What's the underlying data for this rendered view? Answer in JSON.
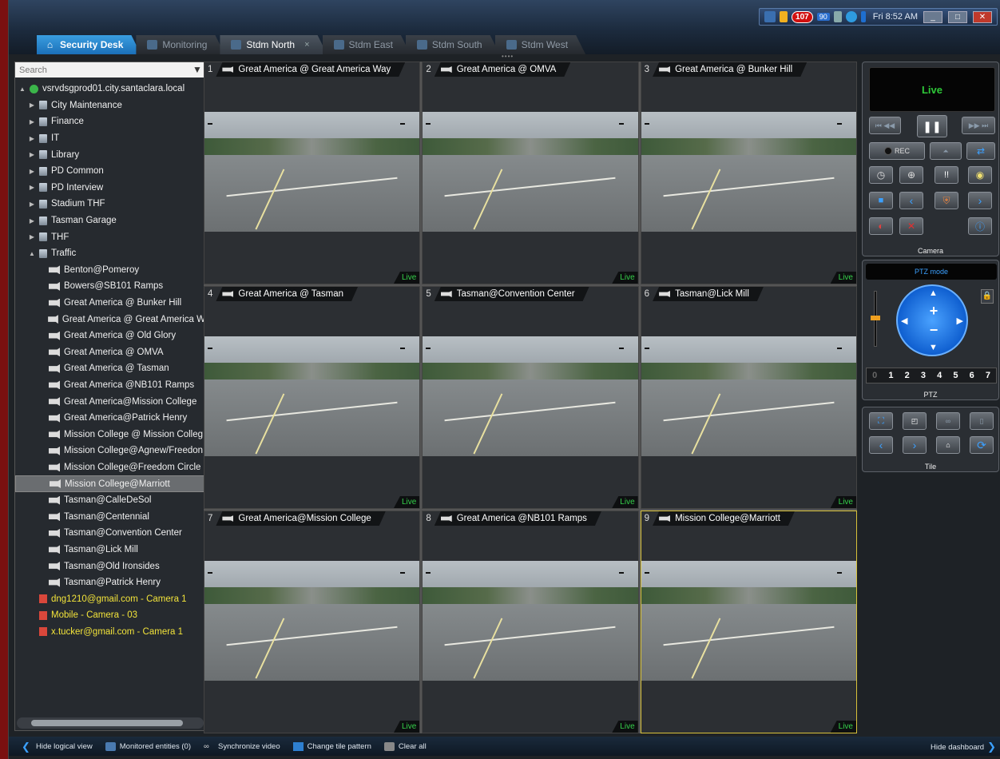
{
  "tray": {
    "alert_count": "107",
    "small_badge": "90",
    "time": "Fri 8:52 AM"
  },
  "tabs": [
    {
      "label": "Security Desk",
      "type": "home"
    },
    {
      "label": "Monitoring",
      "type": "normal"
    },
    {
      "label": "Stdm North",
      "type": "active"
    },
    {
      "label": "Stdm East",
      "type": "normal"
    },
    {
      "label": "Stdm South",
      "type": "normal"
    },
    {
      "label": "Stdm West",
      "type": "normal"
    }
  ],
  "tab_close": "×",
  "search": {
    "placeholder": "Search"
  },
  "tree": [
    {
      "label": "vsrvdsgprod01.city.santaclara.local",
      "level": 0,
      "icon": "server",
      "arrow": "▲"
    },
    {
      "label": "City Maintenance",
      "level": 1,
      "icon": "area",
      "arrow": "▶"
    },
    {
      "label": "Finance",
      "level": 1,
      "icon": "area",
      "arrow": "▶"
    },
    {
      "label": "IT",
      "level": 1,
      "icon": "area",
      "arrow": "▶"
    },
    {
      "label": "Library",
      "level": 1,
      "icon": "area",
      "arrow": "▶"
    },
    {
      "label": "PD Common",
      "level": 1,
      "icon": "area",
      "arrow": "▶"
    },
    {
      "label": "PD Interview",
      "level": 1,
      "icon": "area",
      "arrow": "▶"
    },
    {
      "label": "Stadium THF",
      "level": 1,
      "icon": "area",
      "arrow": "▶"
    },
    {
      "label": "Tasman Garage",
      "level": 1,
      "icon": "area",
      "arrow": "▶"
    },
    {
      "label": "THF",
      "level": 1,
      "icon": "area",
      "arrow": "▶"
    },
    {
      "label": "Traffic",
      "level": 1,
      "icon": "area",
      "arrow": "▲"
    },
    {
      "label": "Benton@Pomeroy",
      "level": 2,
      "icon": "cam"
    },
    {
      "label": "Bowers@SB101 Ramps",
      "level": 2,
      "icon": "cam"
    },
    {
      "label": "Great America @ Bunker Hill",
      "level": 2,
      "icon": "cam"
    },
    {
      "label": "Great America @ Great America W",
      "level": 2,
      "icon": "cam"
    },
    {
      "label": "Great America @ Old Glory",
      "level": 2,
      "icon": "cam"
    },
    {
      "label": "Great America @ OMVA",
      "level": 2,
      "icon": "cam"
    },
    {
      "label": "Great America @ Tasman",
      "level": 2,
      "icon": "cam"
    },
    {
      "label": "Great America @NB101 Ramps",
      "level": 2,
      "icon": "cam"
    },
    {
      "label": "Great America@Mission College",
      "level": 2,
      "icon": "cam"
    },
    {
      "label": "Great America@Patrick Henry",
      "level": 2,
      "icon": "cam"
    },
    {
      "label": "Mission College @ Mission Colleg",
      "level": 2,
      "icon": "cam"
    },
    {
      "label": "Mission College@Agnew/Freedon",
      "level": 2,
      "icon": "cam"
    },
    {
      "label": "Mission College@Freedom Circle",
      "level": 2,
      "icon": "cam"
    },
    {
      "label": "Mission College@Marriott",
      "level": 2,
      "icon": "cam",
      "selected": true
    },
    {
      "label": "Tasman@CalleDeSol",
      "level": 2,
      "icon": "cam"
    },
    {
      "label": "Tasman@Centennial",
      "level": 2,
      "icon": "cam"
    },
    {
      "label": "Tasman@Convention Center",
      "level": 2,
      "icon": "cam"
    },
    {
      "label": "Tasman@Lick Mill",
      "level": 2,
      "icon": "cam"
    },
    {
      "label": "Tasman@Old Ironsides",
      "level": 2,
      "icon": "cam"
    },
    {
      "label": "Tasman@Patrick Henry",
      "level": 2,
      "icon": "cam"
    },
    {
      "label": "dng1210@gmail.com - Camera 1",
      "level": 1,
      "icon": "mob",
      "yellow": true
    },
    {
      "label": "Mobile - Camera - 03",
      "level": 1,
      "icon": "mob",
      "yellow": true
    },
    {
      "label": "x.tucker@gmail.com - Camera 1",
      "level": 1,
      "icon": "mob",
      "yellow": true
    }
  ],
  "tiles": [
    {
      "num": "1",
      "title": "Great America @ Great America Way",
      "status": "Live"
    },
    {
      "num": "2",
      "title": "Great America @ OMVA",
      "status": "Live"
    },
    {
      "num": "3",
      "title": "Great America @ Bunker Hill",
      "status": "Live"
    },
    {
      "num": "4",
      "title": "Great America @ Tasman",
      "status": "Live"
    },
    {
      "num": "5",
      "title": "Tasman@Convention Center",
      "status": "Live"
    },
    {
      "num": "6",
      "title": "Tasman@Lick Mill",
      "status": "Live"
    },
    {
      "num": "7",
      "title": "Great America@Mission College",
      "status": "Live"
    },
    {
      "num": "8",
      "title": "Great America @NB101 Ramps",
      "status": "Live"
    },
    {
      "num": "9",
      "title": "Mission College@Marriott",
      "status": "Live",
      "selected": true
    }
  ],
  "camera_widget": {
    "live_label": "Live",
    "rec_label": "REC",
    "label": "Camera"
  },
  "ptz_widget": {
    "mode_label": "PTZ mode",
    "presets": [
      "0",
      "1",
      "2",
      "3",
      "4",
      "5",
      "6",
      "7"
    ],
    "label": "PTZ"
  },
  "tile_widget": {
    "label": "Tile"
  },
  "bottom": {
    "hide_logical": "Hide logical view",
    "monitored": "Monitored entities (0)",
    "sync": "Synchronize video",
    "change_pattern": "Change tile pattern",
    "clear_all": "Clear all",
    "hide_dashboard": "Hide dashboard"
  },
  "colors": {
    "live_green": "#35d04a",
    "accent_blue": "#3ba0ff",
    "selected_tile_border": "#d8c23a",
    "mobile_yellow": "#f2e33a"
  }
}
